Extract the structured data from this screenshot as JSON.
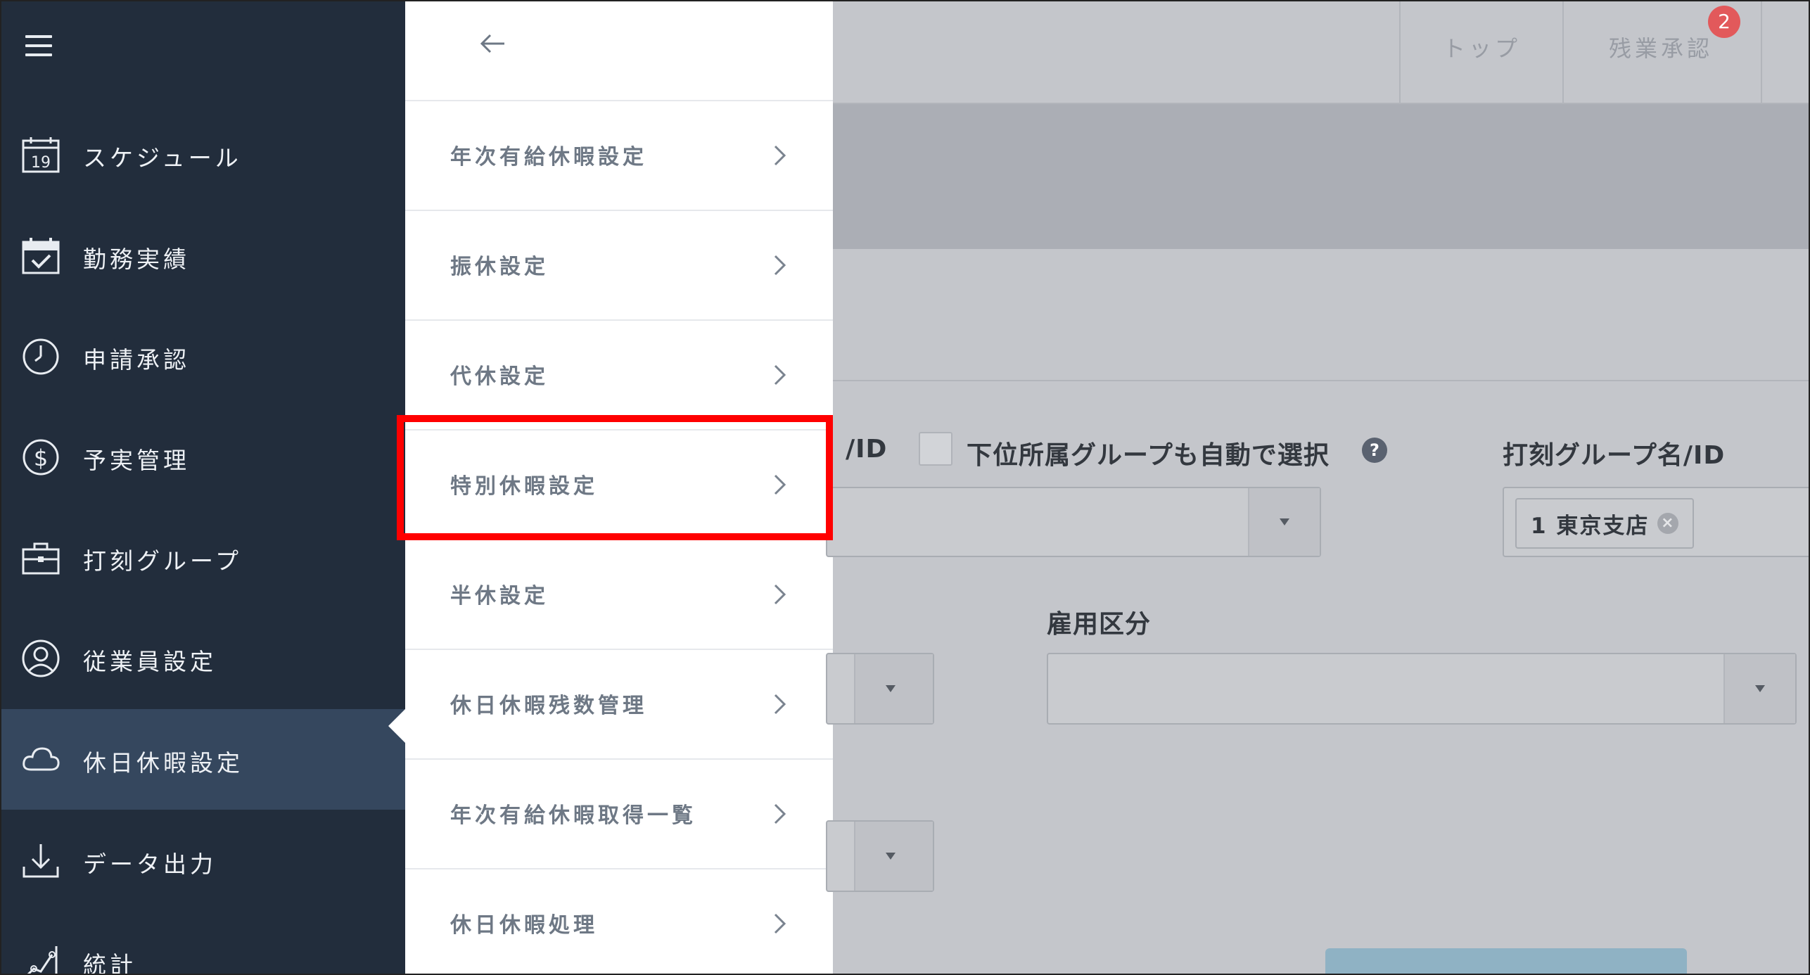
{
  "sidebar": {
    "items": [
      {
        "label": "スケジュール",
        "icon": "calendar-19-icon"
      },
      {
        "label": "勤務実績",
        "icon": "calendar-check-icon"
      },
      {
        "label": "申請承認",
        "icon": "clock-icon"
      },
      {
        "label": "予実管理",
        "icon": "dollar-icon"
      },
      {
        "label": "打刻グループ",
        "icon": "briefcase-icon"
      },
      {
        "label": "従業員設定",
        "icon": "user-icon"
      },
      {
        "label": "休日休暇設定",
        "icon": "cloud-icon",
        "active": true
      },
      {
        "label": "データ出力",
        "icon": "download-icon"
      },
      {
        "label": "統計",
        "icon": "chart-icon"
      }
    ],
    "calendar_day": "19"
  },
  "submenu": {
    "items": [
      {
        "label": "年次有給休暇設定"
      },
      {
        "label": "振休設定"
      },
      {
        "label": "代休設定"
      },
      {
        "label": "特別休暇設定",
        "highlighted": true
      },
      {
        "label": "半休設定"
      },
      {
        "label": "休日休暇残数管理"
      },
      {
        "label": "年次有給休暇取得一覧"
      },
      {
        "label": "休日休暇処理"
      }
    ]
  },
  "topbar": {
    "tabs": [
      {
        "label": "トップ"
      },
      {
        "label": "残業承認",
        "badge": "2"
      }
    ]
  },
  "form": {
    "group_label_fragment": "/ID",
    "auto_select_label": "下位所属グループも自動で選択",
    "help_glyph": "?",
    "punch_group_label": "打刻グループ名/ID",
    "punch_group_tag": "1 東京支店",
    "tag_remove_glyph": "×",
    "employment_label": "雇用区分"
  },
  "colors": {
    "sidebar_bg": "#222d3c",
    "sidebar_active_bg": "#35475e",
    "highlight": "#ff0000",
    "badge": "#e2595b"
  }
}
